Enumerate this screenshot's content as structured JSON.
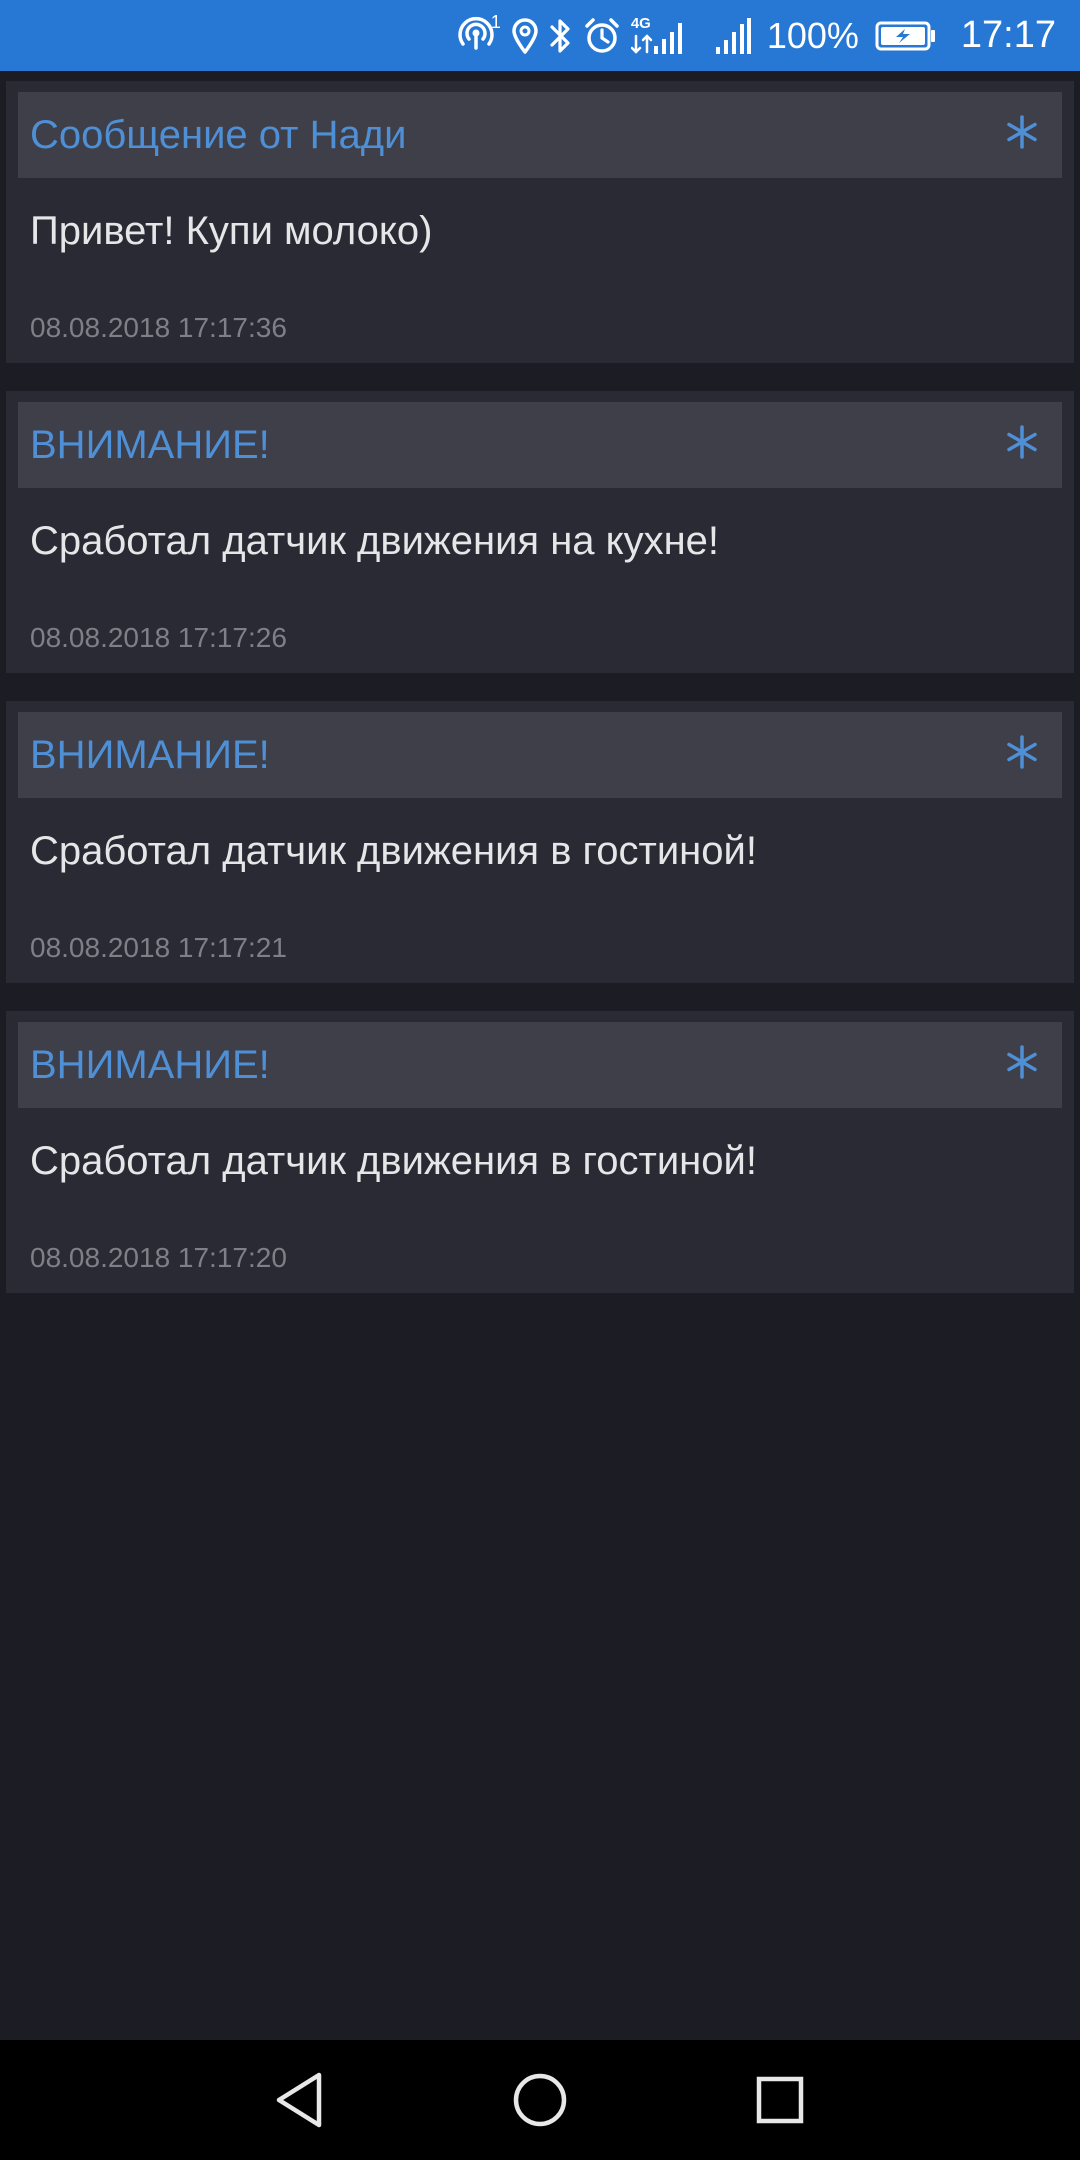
{
  "status_bar": {
    "sim_badge": "1",
    "battery_percent": "100%",
    "time": "17:17",
    "network_label": "4G",
    "icons": [
      "hotspot-icon",
      "location-icon",
      "bluetooth-icon",
      "alarm-icon",
      "mobile-data-icon",
      "signal-icon",
      "battery-charging-icon"
    ],
    "background_color": "#2778d4"
  },
  "messages": [
    {
      "title": "Сообщение от Нади",
      "text": "Привет! Купи молоко)",
      "timestamp": "08.08.2018 17:17:36"
    },
    {
      "title": "ВНИМАНИЕ!",
      "text": "Сработал датчик движения на кухне!",
      "timestamp": "08.08.2018 17:17:26"
    },
    {
      "title": "ВНИМАНИЕ!",
      "text": "Сработал датчик движения в гостиной!",
      "timestamp": "08.08.2018 17:17:21"
    },
    {
      "title": "ВНИМАНИЕ!",
      "text": "Сработал датчик движения в гостиной!",
      "timestamp": "08.08.2018 17:17:20"
    }
  ],
  "star_icon": "asterisk-icon",
  "navigation": {
    "icons": [
      "back-icon",
      "home-icon",
      "recents-icon"
    ]
  },
  "colors": {
    "background": "#1c1d24",
    "card": "#292a33",
    "card_header": "#3e3f48",
    "title_accent": "#4f8fd6",
    "body_text": "#e6e6e8",
    "timestamp_text": "#7e7f87"
  }
}
